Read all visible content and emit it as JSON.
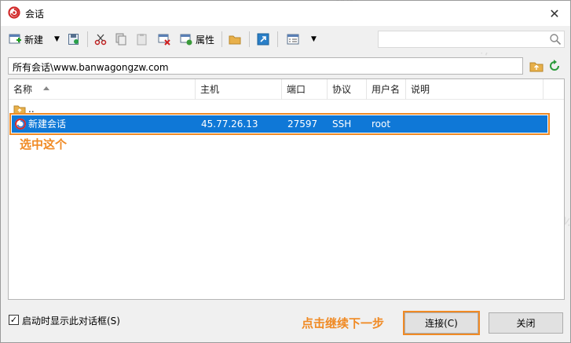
{
  "window": {
    "title": "会话"
  },
  "toolbar": {
    "new_label": "新建",
    "properties_label": "属性"
  },
  "search": {
    "placeholder": ""
  },
  "path": {
    "text": "所有会话\\www.banwagongzw.com"
  },
  "columns": [
    "名称",
    "主机",
    "端口",
    "协议",
    "用户名",
    "说明"
  ],
  "rows": {
    "up": {
      "name": ".."
    },
    "session": {
      "name": "新建会话",
      "host": "45.77.26.13",
      "port": "27597",
      "protocol": "SSH",
      "user": "root",
      "desc": ""
    }
  },
  "annotations": {
    "select_this": "选中这个",
    "click_next": "点击继续下一步"
  },
  "footer": {
    "show_dialog_label": "启动时显示此对话框(S)",
    "show_dialog_checked": true,
    "connect_label": "连接(C)",
    "close_label": "关闭"
  },
  "watermark": "www.banwagongzw.com",
  "colors": {
    "selection": "#0f78d7",
    "annotation": "#f08a24"
  }
}
